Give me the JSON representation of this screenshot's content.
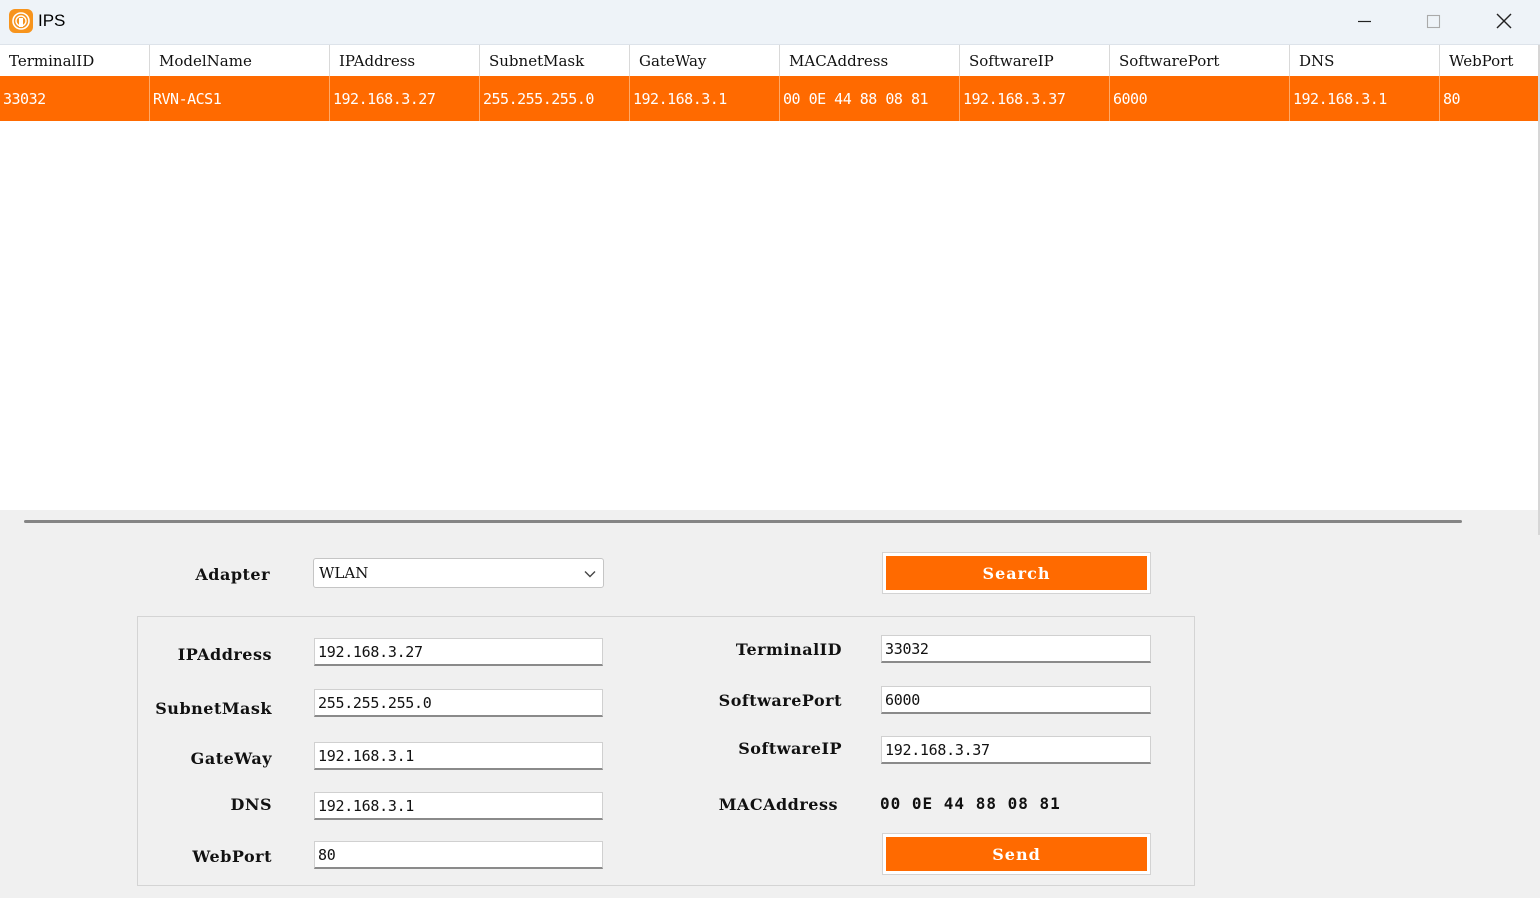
{
  "window": {
    "title": "IPS"
  },
  "grid": {
    "columns": [
      "TerminalID",
      "ModelName",
      "IPAddress",
      "SubnetMask",
      "GateWay",
      "MACAddress",
      "SoftwareIP",
      "SoftwarePort",
      "DNS",
      "WebPort"
    ],
    "rows": [
      [
        "33032",
        "RVN-ACS1",
        "192.168.3.27",
        "255.255.255.0",
        "192.168.3.1",
        "00 0E 44 88 08 81",
        "192.168.3.37",
        "6000",
        "192.168.3.1",
        "80"
      ]
    ]
  },
  "adapter": {
    "label": "Adapter",
    "value": "WLAN"
  },
  "buttons": {
    "search": "Search",
    "send": "Send"
  },
  "form": {
    "ipaddress_label": "IPAddress",
    "ipaddress": "192.168.3.27",
    "subnetmask_label": "SubnetMask",
    "subnetmask": "255.255.255.0",
    "gateway_label": "GateWay",
    "gateway": "192.168.3.1",
    "dns_label": "DNS",
    "dns": "192.168.3.1",
    "webport_label": "WebPort",
    "webport": "80",
    "terminalid_label": "TerminalID",
    "terminalid": "33032",
    "softwareport_label": "SoftwarePort",
    "softwareport": "6000",
    "softwareip_label": "SoftwareIP",
    "softwareip": "192.168.3.37",
    "macaddress_label": "MACAddress",
    "macaddress": "00 0E 44 88 08 81"
  },
  "colors": {
    "accent": "#ff6a00",
    "titlebar": "#eef3f8",
    "panel": "#f0f0f0"
  },
  "icons": {
    "app": "ips-app-icon",
    "minimize": "minimize-icon",
    "maximize": "maximize-icon",
    "close": "close-icon",
    "dropdown": "chevron-down-icon"
  }
}
